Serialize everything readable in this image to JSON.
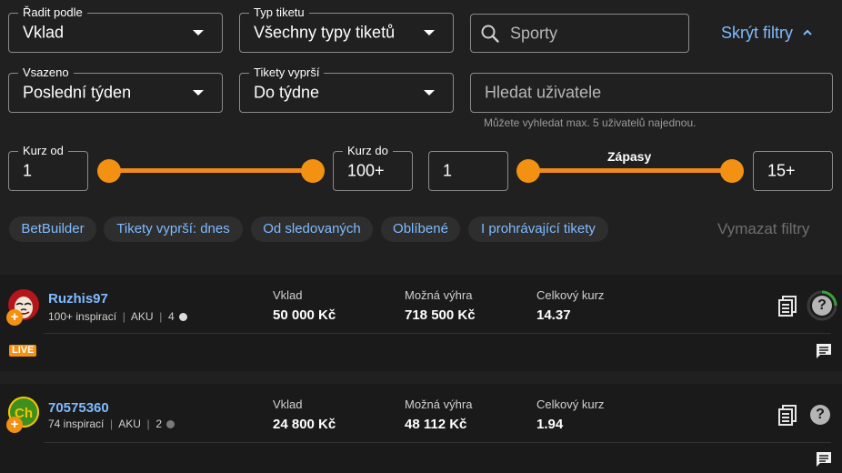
{
  "filters": {
    "sort": {
      "label": "Řadit podle",
      "value": "Vklad"
    },
    "ticket_type": {
      "label": "Typ tiketu",
      "value": "Všechny typy tiketů"
    },
    "sports_search": {
      "placeholder": "Sporty"
    },
    "hide_filters": "Skrýt filtry",
    "wagered": {
      "label": "Vsazeno",
      "value": "Poslední týden"
    },
    "expires": {
      "label": "Tikety vyprší",
      "value": "Do týdne"
    },
    "user_search": {
      "placeholder": "Hledat uživatele",
      "hint": "Můžete vyhledat max. 5 uživatelů najednou."
    },
    "odds": {
      "from_label": "Kurz od",
      "from_value": "1",
      "to_label": "Kurz do",
      "to_value": "100+"
    },
    "matches": {
      "label": "Zápasy",
      "from_value": "1",
      "to_value": "15+"
    },
    "chips": [
      "BetBuilder",
      "Tikety vyprší: dnes",
      "Od sledovaných",
      "Oblíbené",
      "I prohrávající tikety"
    ],
    "clear_filters": "Vymazat filtry"
  },
  "tickets": [
    {
      "username": "Ruzhis97",
      "inspirations": "100+ inspirací",
      "type": "AKU",
      "count": "4",
      "live_badge": "LIVE",
      "stake_label": "Vklad",
      "stake": "50 000 Kč",
      "win_label": "Možná výhra",
      "win": "718 500 Kč",
      "odds_label": "Celkový kurz",
      "odds": "14.37"
    },
    {
      "username": "70575360",
      "inspirations": "74 inspirací",
      "type": "AKU",
      "count": "2",
      "stake_label": "Vklad",
      "stake": "24 800 Kč",
      "win_label": "Možná výhra",
      "win": "48 112 Kč",
      "odds_label": "Celkový kurz",
      "odds": "1.94"
    }
  ],
  "colors": {
    "accent": "#f39112",
    "link": "#7fbbff",
    "background": "#202020",
    "card": "#1a1a1a"
  }
}
